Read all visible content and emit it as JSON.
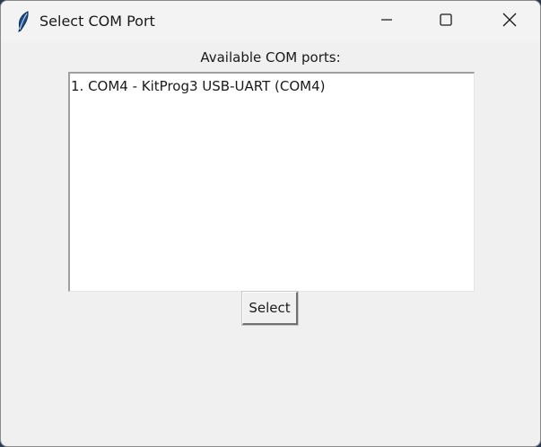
{
  "window": {
    "title": "Select COM Port",
    "app_icon": "feather-icon",
    "controls": {
      "minimize_icon": "minimize-icon",
      "maximize_icon": "maximize-icon",
      "close_icon": "close-icon"
    }
  },
  "main": {
    "header_label": "Available COM ports:",
    "ports": [
      "1. COM4 - KitProg3 USB-UART (COM4)"
    ],
    "select_button_label": "Select"
  }
}
